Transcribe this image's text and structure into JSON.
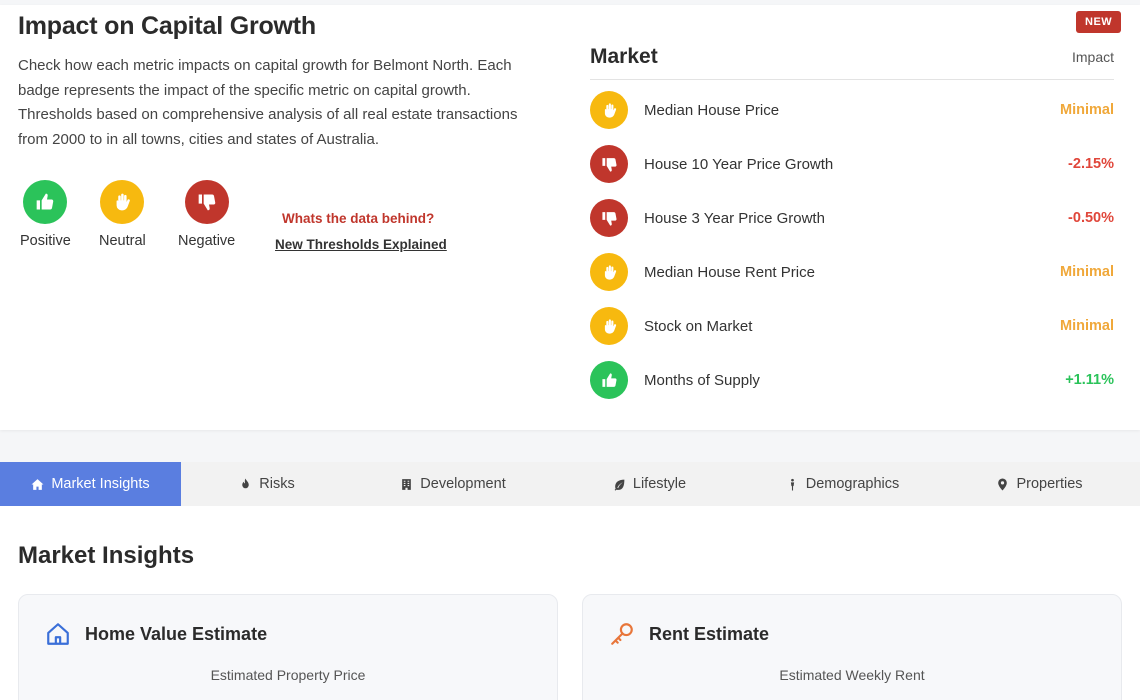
{
  "impact": {
    "title": "Impact on Capital Growth",
    "description": "Check how each metric impacts on capital growth for Belmont North. Each badge represents the impact of the specific metric on capital growth. Thresholds based on comprehensive analysis of all real estate transactions from 2000 to in all towns, cities and states of Australia.",
    "legend": {
      "positive": "Positive",
      "neutral": "Neutral",
      "negative": "Negative"
    },
    "data_behind": "Whats the data behind?",
    "thresholds_link": "New Thresholds Explained",
    "new_badge": "NEW"
  },
  "market": {
    "title": "Market",
    "impact_label": "Impact",
    "rows": [
      {
        "label": "Median House Price",
        "value": "Minimal",
        "status": "neutral",
        "icon": "hand-icon",
        "color": "#f0a83a"
      },
      {
        "label": "House 10 Year Price Growth",
        "value": "-2.15%",
        "status": "negative",
        "icon": "thumbs-down-icon",
        "color": "#e0463a"
      },
      {
        "label": "House 3 Year Price Growth",
        "value": "-0.50%",
        "status": "negative",
        "icon": "thumbs-down-icon",
        "color": "#e0463a"
      },
      {
        "label": "Median House Rent Price",
        "value": "Minimal",
        "status": "neutral",
        "icon": "hand-icon",
        "color": "#f0a83a"
      },
      {
        "label": "Stock on Market",
        "value": "Minimal",
        "status": "neutral",
        "icon": "hand-icon",
        "color": "#f0a83a"
      },
      {
        "label": "Months of Supply",
        "value": "+1.11%",
        "status": "positive",
        "icon": "thumbs-up-icon",
        "color": "#2bc35a"
      }
    ]
  },
  "tabs": [
    {
      "label": "Market Insights",
      "icon": "home-icon",
      "active": true
    },
    {
      "label": "Risks",
      "icon": "fire-icon"
    },
    {
      "label": "Development",
      "icon": "building-icon"
    },
    {
      "label": "Lifestyle",
      "icon": "leaf-icon"
    },
    {
      "label": "Demographics",
      "icon": "person-icon"
    },
    {
      "label": "Properties",
      "icon": "map-pin-icon"
    }
  ],
  "insights": {
    "title": "Market Insights",
    "home_value": {
      "title": "Home Value Estimate",
      "subtitle": "Estimated Property Price",
      "icon": "house-outline-icon"
    },
    "rent": {
      "title": "Rent Estimate",
      "subtitle": "Estimated Weekly Rent",
      "icon": "key-icon"
    }
  },
  "colors": {
    "positive": "#2bc35a",
    "neutral": "#f7b90f",
    "negative": "#c0362c",
    "accent": "#5a7ee0"
  }
}
